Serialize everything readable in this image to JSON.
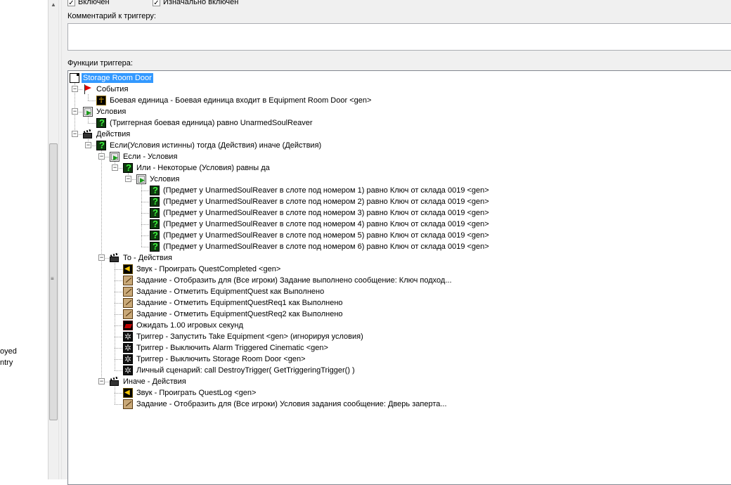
{
  "left_pane": {
    "fragments": [
      "oyed",
      "ntry"
    ]
  },
  "header": {
    "enabled_label": "Включен",
    "enabled_checked": true,
    "initially_enabled_label": "Изначально включен",
    "initially_enabled_checked": true,
    "comment_label": "Комментарий к триггеру:",
    "comment_value": "",
    "functions_label": "Функции триггера:"
  },
  "tree": {
    "nodes": [
      {
        "id": "root",
        "depth": 0,
        "icon": "page-icon",
        "text": "Storage Room Door",
        "selected": true,
        "expand": null
      },
      {
        "id": "events",
        "depth": 1,
        "icon": "flag-icon",
        "text": "События",
        "expand": "-",
        "parent": "root"
      },
      {
        "id": "e1",
        "depth": 2,
        "icon": "unit-icon",
        "text": "Боевая единица - Боевая единица входит в Equipment Room Door <gen>",
        "expand": null,
        "parent": "events"
      },
      {
        "id": "conds",
        "depth": 1,
        "icon": "condition-icon",
        "text": "Условия",
        "expand": "-",
        "parent": "root"
      },
      {
        "id": "c1",
        "depth": 2,
        "icon": "question-icon",
        "text": "(Триггерная боевая единица) равно UnarmedSoulReaver",
        "expand": null,
        "parent": "conds"
      },
      {
        "id": "acts",
        "depth": 1,
        "icon": "clapper-icon",
        "text": "Действия",
        "expand": "-",
        "parent": "root"
      },
      {
        "id": "if",
        "depth": 2,
        "icon": "question-icon",
        "text": "Если(Условия истинны) тогда (Действия) иначе (Действия)",
        "expand": "-",
        "parent": "acts"
      },
      {
        "id": "ifconds",
        "depth": 3,
        "icon": "condition-icon",
        "text": "Если - Условия",
        "expand": "-",
        "parent": "if"
      },
      {
        "id": "or",
        "depth": 4,
        "icon": "question-icon",
        "text": "Или - Некоторые (Условия) равны да",
        "expand": "-",
        "parent": "ifconds"
      },
      {
        "id": "orconds",
        "depth": 5,
        "icon": "condition-icon",
        "text": "Условия",
        "expand": "-",
        "parent": "or"
      },
      {
        "id": "oc1",
        "depth": 6,
        "icon": "question-icon",
        "text": "(Предмет у UnarmedSoulReaver в слоте под номером 1) равно Ключ от склада 0019 <gen>",
        "expand": null,
        "parent": "orconds"
      },
      {
        "id": "oc2",
        "depth": 6,
        "icon": "question-icon",
        "text": "(Предмет у UnarmedSoulReaver в слоте под номером 2) равно Ключ от склада 0019 <gen>",
        "expand": null,
        "parent": "orconds"
      },
      {
        "id": "oc3",
        "depth": 6,
        "icon": "question-icon",
        "text": "(Предмет у UnarmedSoulReaver в слоте под номером 3) равно Ключ от склада 0019 <gen>",
        "expand": null,
        "parent": "orconds"
      },
      {
        "id": "oc4",
        "depth": 6,
        "icon": "question-icon",
        "text": "(Предмет у UnarmedSoulReaver в слоте под номером 4) равно Ключ от склада 0019 <gen>",
        "expand": null,
        "parent": "orconds"
      },
      {
        "id": "oc5",
        "depth": 6,
        "icon": "question-icon",
        "text": "(Предмет у UnarmedSoulReaver в слоте под номером 5) равно Ключ от склада 0019 <gen>",
        "expand": null,
        "parent": "orconds"
      },
      {
        "id": "oc6",
        "depth": 6,
        "icon": "question-icon",
        "text": "(Предмет у UnarmedSoulReaver в слоте под номером 6) равно Ключ от склада 0019 <gen>",
        "expand": null,
        "parent": "orconds"
      },
      {
        "id": "then",
        "depth": 3,
        "icon": "clapper-icon",
        "text": "То - Действия",
        "expand": "-",
        "parent": "if"
      },
      {
        "id": "t1",
        "depth": 4,
        "icon": "sound-icon",
        "text": "Звук - Проиграть QuestCompleted <gen>",
        "expand": null,
        "parent": "then"
      },
      {
        "id": "t2",
        "depth": 4,
        "icon": "quest-icon",
        "text": "Задание - Отобразить для (Все игроки) Задание выполнено сообщение: Ключ подход...",
        "expand": null,
        "parent": "then"
      },
      {
        "id": "t3",
        "depth": 4,
        "icon": "quest-icon",
        "text": "Задание - Отметить EquipmentQuest как Выполнено",
        "expand": null,
        "parent": "then"
      },
      {
        "id": "t4",
        "depth": 4,
        "icon": "quest-icon",
        "text": "Задание - Отметить EquipmentQuestReq1 как Выполнено",
        "expand": null,
        "parent": "then"
      },
      {
        "id": "t5",
        "depth": 4,
        "icon": "quest-icon",
        "text": "Задание - Отметить EquipmentQuestReq2 как Выполнено",
        "expand": null,
        "parent": "then"
      },
      {
        "id": "t6",
        "depth": 4,
        "icon": "wait-icon",
        "text": "Ожидать 1.00 игровых секунд",
        "expand": null,
        "parent": "then"
      },
      {
        "id": "t7",
        "depth": 4,
        "icon": "trigger-icon",
        "text": "Триггер - Запустить Take Equipment <gen> (игнорируя условия)",
        "expand": null,
        "parent": "then"
      },
      {
        "id": "t8",
        "depth": 4,
        "icon": "trigger-icon",
        "text": "Триггер - Выключить Alarm Triggered Cinematic <gen>",
        "expand": null,
        "parent": "then"
      },
      {
        "id": "t9",
        "depth": 4,
        "icon": "trigger-icon",
        "text": "Триггер - Выключить Storage Room Door <gen>",
        "expand": null,
        "parent": "then"
      },
      {
        "id": "t10",
        "depth": 4,
        "icon": "trigger-icon",
        "text": "Личный сценарий:   call DestroyTrigger( GetTriggeringTrigger() )",
        "expand": null,
        "parent": "then"
      },
      {
        "id": "else",
        "depth": 3,
        "icon": "clapper-icon",
        "text": "Иначе - Действия",
        "expand": "-",
        "parent": "if"
      },
      {
        "id": "x1",
        "depth": 4,
        "icon": "sound-icon",
        "text": "Звук - Проиграть QuestLog <gen>",
        "expand": null,
        "parent": "else"
      },
      {
        "id": "x2",
        "depth": 4,
        "icon": "quest-icon",
        "text": "Задание - Отобразить для (Все игроки) Условия задания сообщение: Дверь заперта...",
        "expand": null,
        "parent": "else"
      }
    ]
  }
}
